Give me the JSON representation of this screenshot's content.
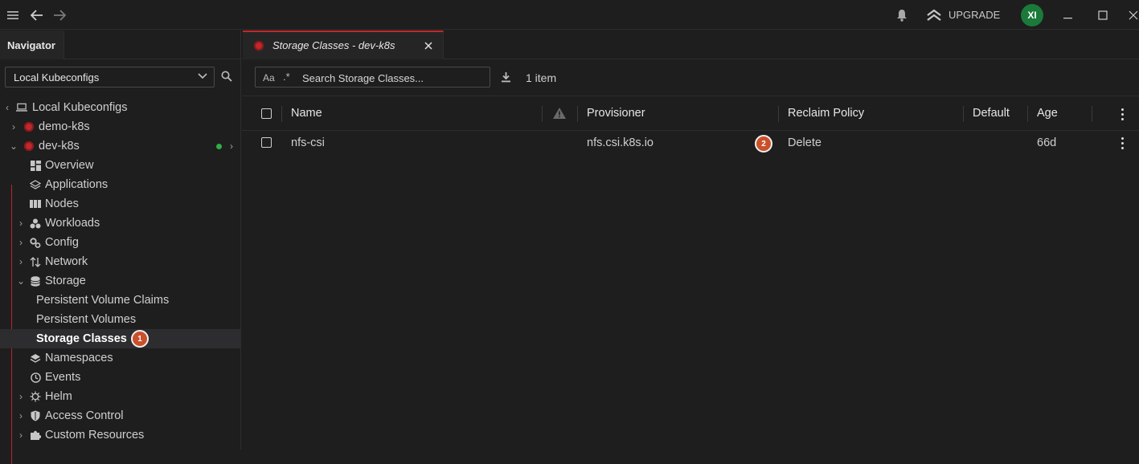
{
  "topbar": {
    "upgrade_label": "UPGRADE",
    "avatar_initials": "XI"
  },
  "navigator": {
    "tab_label": "Navigator",
    "kubeconfig_select": "Local Kubeconfigs",
    "tree": {
      "root": "Local Kubeconfigs",
      "clusters": [
        "demo-k8s",
        "dev-k8s"
      ],
      "items": {
        "overview": "Overview",
        "applications": "Applications",
        "nodes": "Nodes",
        "workloads": "Workloads",
        "config": "Config",
        "network": "Network",
        "storage": "Storage",
        "pvc": "Persistent Volume Claims",
        "pv": "Persistent Volumes",
        "storage_classes": "Storage Classes",
        "namespaces": "Namespaces",
        "events": "Events",
        "helm": "Helm",
        "access_control": "Access Control",
        "custom_resources": "Custom Resources"
      }
    },
    "badge_1": "1"
  },
  "main": {
    "tab_title": "Storage Classes - dev-k8s",
    "search_case": "Aa",
    "search_regex": ".*",
    "search_placeholder": "Search Storage Classes...",
    "item_count": "1 item",
    "columns": {
      "name": "Name",
      "provisioner": "Provisioner",
      "reclaim_policy": "Reclaim Policy",
      "default": "Default",
      "age": "Age"
    },
    "rows": [
      {
        "name": "nfs-csi",
        "provisioner": "nfs.csi.k8s.io",
        "reclaim_policy": "Delete",
        "default": "",
        "age": "66d"
      }
    ],
    "badge_2": "2"
  },
  "colors": {
    "accent_red": "#c0282c",
    "status_green": "#2fae46",
    "badge_orange": "#c9502b",
    "avatar_green": "#1b7a3a"
  }
}
